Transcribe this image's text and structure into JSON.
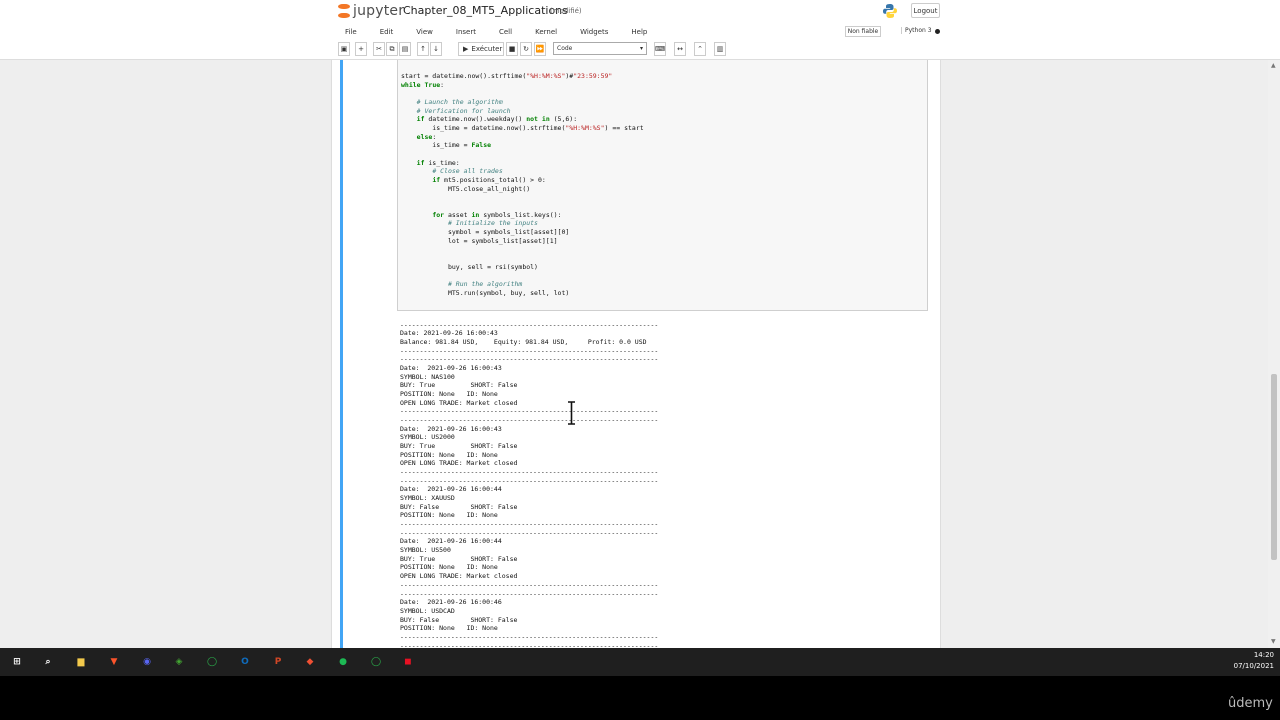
{
  "header": {
    "logo_text": "jupyter",
    "notebook_name": "Chapter_08_MT5_Applications",
    "save_state": "(modifié)",
    "logout_label": "Logout"
  },
  "menu": {
    "items": [
      "File",
      "Edit",
      "View",
      "Insert",
      "Cell",
      "Kernel",
      "Widgets",
      "Help"
    ]
  },
  "status": {
    "trusted_label": "Non fiable",
    "kernel_name": "Python 3"
  },
  "toolbar": {
    "run_label": "Exécuter",
    "cell_type": "Code"
  },
  "code_lines": [
    "start = datetime.now().strftime(\"%H:%M:%S\")#\"23:59:59\"",
    "while True:",
    "",
    "    # Launch the algorithm",
    "    # Verfication for launch",
    "    if datetime.now().weekday() not in (5,6):",
    "        is_time = datetime.now().strftime(\"%H:%M:%S\") == start",
    "    else:",
    "        is_time = False",
    "",
    "    if is_time:",
    "        # Close all trades",
    "        if mt5.positions_total() > 0:",
    "            MT5.close_all_night()",
    "",
    "",
    "        for asset in symbols_list.keys():",
    "            # Initialize the inputs",
    "            symbol = symbols_list[asset][0]",
    "            lot = symbols_list[asset][1]",
    "",
    "",
    "            buy, sell = rsi(symbol)",
    "",
    "            # Run the algorithm",
    "            MT5.run(symbol, buy, sell, lot)"
  ],
  "output_lines": [
    "",
    "------------------------------------------------------------------",
    "Date: 2021-09-26 16:00:43",
    "Balance: 981.84 USD,    Equity: 981.84 USD,     Profit: 0.0 USD",
    "------------------------------------------------------------------",
    "------------------------------------------------------------------",
    "Date:  2021-09-26 16:00:43",
    "SYMBOL: NAS100",
    "BUY: True         SHORT: False",
    "POSITION: None   ID: None",
    "OPEN LONG TRADE: Market closed",
    "------------------------------------------------------------------",
    "------------------------------------------------------------------",
    "Date:  2021-09-26 16:00:43",
    "SYMBOL: US2000",
    "BUY: True         SHORT: False",
    "POSITION: None   ID: None",
    "OPEN LONG TRADE: Market closed",
    "------------------------------------------------------------------",
    "------------------------------------------------------------------",
    "Date:  2021-09-26 16:00:44",
    "SYMBOL: XAUUSD",
    "BUY: False        SHORT: False",
    "POSITION: None   ID: None",
    "------------------------------------------------------------------",
    "------------------------------------------------------------------",
    "Date:  2021-09-26 16:00:44",
    "SYMBOL: US500",
    "BUY: True         SHORT: False",
    "POSITION: None   ID: None",
    "OPEN LONG TRADE: Market closed",
    "------------------------------------------------------------------",
    "------------------------------------------------------------------",
    "Date:  2021-09-26 16:00:46",
    "SYMBOL: USDCAD",
    "BUY: False        SHORT: False",
    "POSITION: None   ID: None",
    "------------------------------------------------------------------",
    "------------------------------------------------------------------",
    "Date:  2021-09-26 16:00:46"
  ],
  "taskbar": {
    "time": "14:20",
    "date": "07/10/2021",
    "apps": [
      {
        "name": "start-menu-icon",
        "color": "#ffffff"
      },
      {
        "name": "search-icon",
        "color": "#ffffff"
      },
      {
        "name": "file-explorer-icon",
        "color": "#f2c94c"
      },
      {
        "name": "brave-browser-icon",
        "color": "#fb542b"
      },
      {
        "name": "discord-icon",
        "color": "#5865f2"
      },
      {
        "name": "anaconda-icon",
        "color": "#44a833"
      },
      {
        "name": "refresh-app-icon",
        "color": "#2bb24c"
      },
      {
        "name": "outlook-icon",
        "color": "#0f6cbd"
      },
      {
        "name": "powerpoint-icon",
        "color": "#d24726"
      },
      {
        "name": "git-icon",
        "color": "#f05033"
      },
      {
        "name": "spotify-icon",
        "color": "#1db954"
      },
      {
        "name": "sync-app-icon",
        "color": "#2bb24c"
      },
      {
        "name": "presenter-app-icon",
        "color": "#e81123"
      }
    ]
  },
  "watermark": "ûdemy"
}
